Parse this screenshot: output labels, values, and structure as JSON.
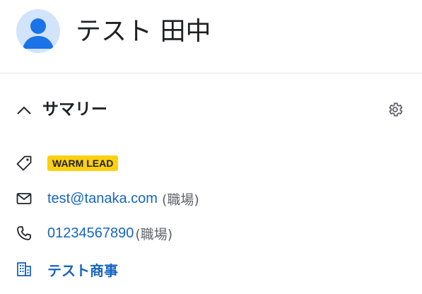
{
  "contact": {
    "name": "テスト 田中"
  },
  "summary": {
    "title": "サマリー",
    "badge": "WARM LEAD",
    "email": "test@tanaka.com",
    "email_type": "(職場)",
    "phone": "01234567890",
    "phone_type": "(職場)",
    "company": "テスト商事"
  },
  "icons": {
    "avatar": "person-avatar-icon",
    "collapse": "chevron-up-icon",
    "settings": "gear-icon",
    "tag": "tag-icon",
    "email": "mail-icon",
    "phone": "phone-icon",
    "company": "building-icon"
  },
  "colors": {
    "accent": "#1765c1",
    "avatar_bg": "#d2e3fc",
    "avatar_fg": "#1a73e8",
    "badge_bg": "#fcd012",
    "muted": "#5f6368"
  }
}
